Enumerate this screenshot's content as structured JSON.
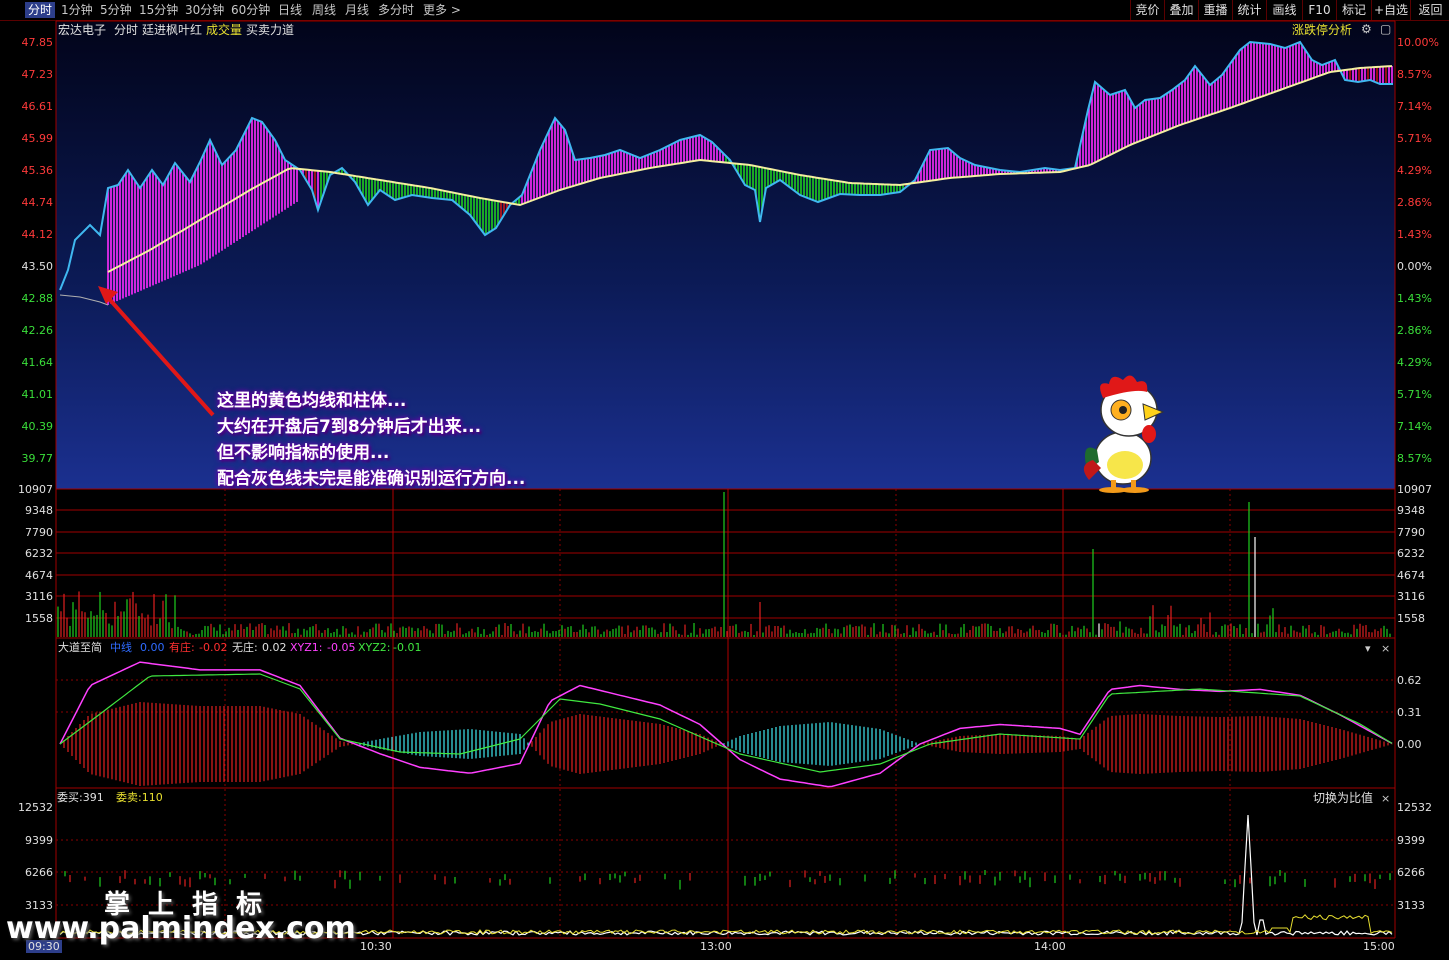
{
  "toolbar": {
    "periods": [
      "分时",
      "1分钟",
      "5分钟",
      "15分钟",
      "30分钟",
      "60分钟",
      "日线",
      "周线",
      "月线",
      "多分时",
      "更多 >"
    ],
    "right": [
      "竞价",
      "叠加",
      "重播",
      "统计",
      "画线",
      "F10",
      "标记",
      "+自选",
      "返回"
    ]
  },
  "main": {
    "stock": "宏达电子",
    "mode": "分时",
    "indicator": "廷进枫叶红",
    "vol_label": "成交量",
    "flow_label": "买卖力道",
    "limit_btn": "涨跌停分析",
    "prices": [
      "47.85",
      "47.23",
      "46.61",
      "45.99",
      "45.36",
      "44.74",
      "44.12",
      "43.50",
      "42.88",
      "42.26",
      "41.64",
      "41.01",
      "40.39",
      "39.77"
    ],
    "pcts": [
      "10.00%",
      "8.57%",
      "7.14%",
      "5.71%",
      "4.29%",
      "2.86%",
      "1.43%",
      "0.00%",
      "1.43%",
      "2.86%",
      "4.29%",
      "5.71%",
      "7.14%",
      "8.57%"
    ]
  },
  "annotation": [
    "这里的黄色均线和柱体...",
    "大约在开盘后7到8分钟后才出来...",
    "但不影响指标的使用...",
    "配合灰色线未完是能准确识别运行方向..."
  ],
  "volume": {
    "ticks": [
      "10907",
      "9348",
      "7790",
      "6232",
      "4674",
      "3116",
      "1558"
    ]
  },
  "dadao": {
    "name": "大道至简",
    "zx_label": "中线",
    "zx_val": "0.00",
    "yz_label": "有庄:",
    "yz_val": "-0.02",
    "wz_label": "无庄:",
    "wz_val": "0.02",
    "x1_label": "XYZ1:",
    "x1_val": "-0.05",
    "x2_label": "XYZ2:",
    "x2_val": "-0.01",
    "ticks": [
      "0.62",
      "0.31",
      "0.00"
    ]
  },
  "orders": {
    "buy": "委买:391",
    "sell": "委卖:110",
    "switch": "切换为比值",
    "ticks": [
      "12532",
      "9399",
      "6266",
      "3133"
    ]
  },
  "times": [
    "09:30",
    "10:30",
    "13:00",
    "14:00",
    "15:00"
  ],
  "watermark": {
    "cn": "掌上指标",
    "url": "www.palmindex.com"
  },
  "colors": {
    "grid": "#8a0000",
    "price_line": "#3fb8f0",
    "avg_line": "#f4f0a0",
    "magenta": "#ff2cff",
    "green": "#1fcf1f",
    "red": "#e02020"
  }
}
